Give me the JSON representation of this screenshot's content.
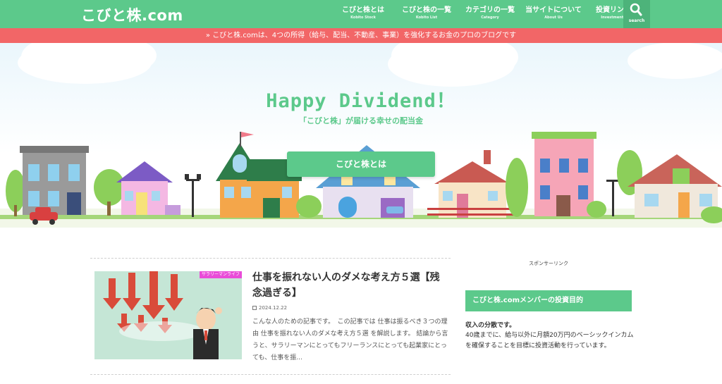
{
  "site": {
    "logo": "こびと株.com"
  },
  "nav": [
    {
      "label": "こびと株とは",
      "sub": "Kobito Stock"
    },
    {
      "label": "こびと株の一覧",
      "sub": "Kobito List"
    },
    {
      "label": "カテゴリの一覧",
      "sub": "Category"
    },
    {
      "label": "当サイトについて",
      "sub": "About Us"
    },
    {
      "label": "投資リンク集",
      "sub": "Investment Link"
    }
  ],
  "search": {
    "label": "search",
    "icon": "search-icon"
  },
  "notice": "» こびと株.comは、4つの所得（給与、配当、不動産、事業）を強化するお金のプロのブログです",
  "hero": {
    "title": "Happy Dividend！",
    "subtitle": "「こびと株」が届ける幸せの配当金",
    "button": "こびと株とは"
  },
  "article": {
    "category": "サラリーマンライフ",
    "title": "仕事を振れない人のダメな考え方５選【残念過ぎる】",
    "date": "2024.12.22",
    "excerpt": "こんな人のための記事です。　この記事では 仕事は振るべき３つの理由 仕事を振れない人のダメな考え方５選 を解説します。 結論から言うと、サラリーマンにとってもフリーランスにとっても起業家にとっても、仕事を振..."
  },
  "sidebar": {
    "sponsor": "スポンサーリンク",
    "widget_title": "こびと株.comメンバーの投資目的",
    "widget_strong": "収入の分散です。",
    "widget_body": "40歳までに、給与以外に月額20万円のベーシックインカムを確保することを目標に投資活動を行っています。"
  },
  "colors": {
    "brand_green": "#5cc98b",
    "notice_red": "#f26667",
    "badge_pink": "#e94cd8"
  }
}
